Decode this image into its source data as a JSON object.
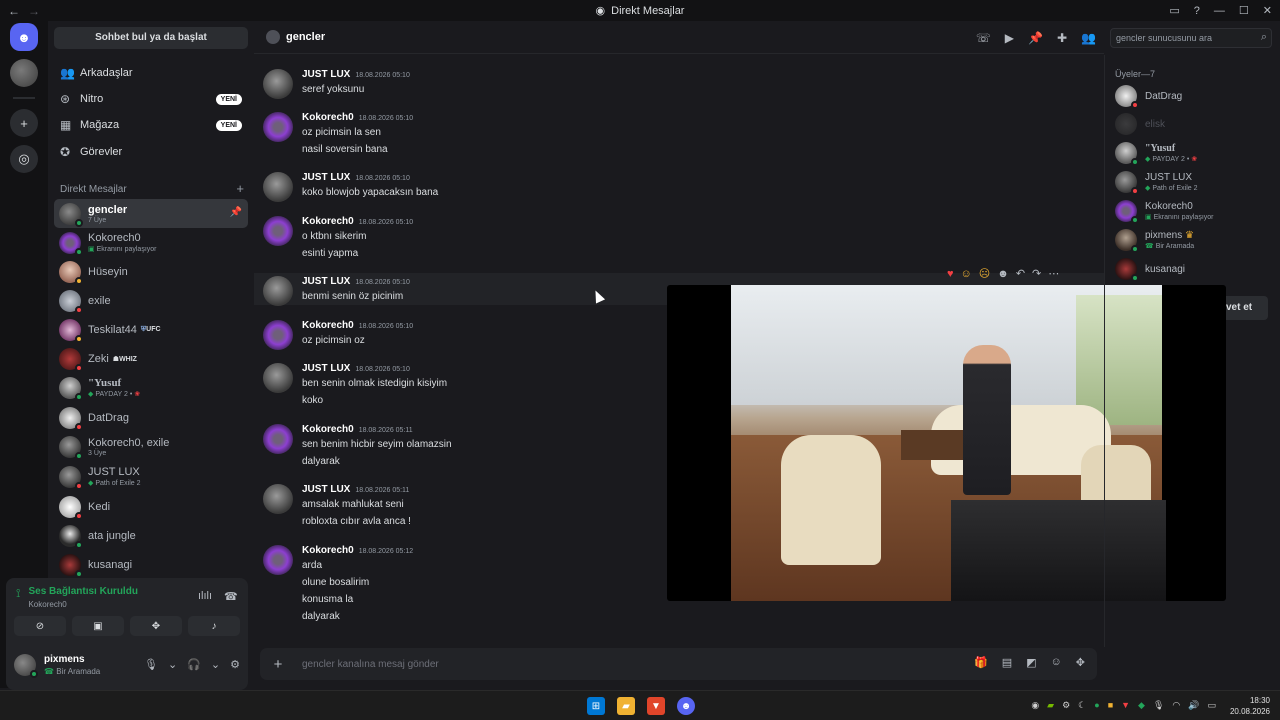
{
  "window": {
    "title": "Direkt Mesajlar"
  },
  "colors": {
    "accent": "#5865f2",
    "online": "#23a55a",
    "dnd": "#f23f43",
    "idle": "#f0b232",
    "voice": "#23a55a"
  },
  "sidebar": {
    "find_button": "Sohbet bul ya da başlat",
    "nav": [
      {
        "label": "Arkadaşlar",
        "icon": "friends-icon"
      },
      {
        "label": "Nitro",
        "icon": "nitro-icon",
        "badge": "YENİ"
      },
      {
        "label": "Mağaza",
        "icon": "shop-icon",
        "badge": "YENİ"
      },
      {
        "label": "Görevler",
        "icon": "quests-icon"
      }
    ],
    "dm_header": "Direkt Mesajlar",
    "dm_add": "+",
    "dms": [
      {
        "name": "gencler",
        "sub": "7 Üye",
        "selected": true
      },
      {
        "name": "Kokorech0",
        "sub": "Ekranını paylaşıyor"
      },
      {
        "name": "Hüseyin",
        "sub": ""
      },
      {
        "name": "exile",
        "sub": ""
      },
      {
        "name": "Teskilat44",
        "sub": "",
        "tag": "UFC"
      },
      {
        "name": "Zeki",
        "sub": "",
        "tag": "WHIZ"
      },
      {
        "name": "\"Yusuf",
        "sub": "PAYDAY 2 •"
      },
      {
        "name": "DatDrag",
        "sub": ""
      },
      {
        "name": "Kokorech0, exile",
        "sub": "3 Üye"
      },
      {
        "name": "JUST LUX",
        "sub": "Path of Exile 2"
      },
      {
        "name": "Kedi",
        "sub": ""
      },
      {
        "name": "ata jungle",
        "sub": ""
      },
      {
        "name": "kusanagi",
        "sub": ""
      }
    ]
  },
  "voice": {
    "title": "Ses Bağlantısı Kuruldu",
    "channel": "Kokorech0"
  },
  "user": {
    "name": "pixmens",
    "status": "Bir Aramada"
  },
  "chat": {
    "channel": "gencler",
    "search_placeholder": "gencler sunucusunu ara",
    "input_placeholder": "gencler kanalına mesaj gönder",
    "messages": [
      {
        "author": "JUST LUX",
        "time": "18.08.2026 05:10",
        "lines": [
          "seref yoksunu"
        ],
        "av": "av-lux"
      },
      {
        "author": "Kokorech0",
        "time": "18.08.2026 05:10",
        "lines": [
          "oz picimsin la sen",
          "nasil soversin bana"
        ],
        "av": "av-kok"
      },
      {
        "author": "JUST LUX",
        "time": "18.08.2026 05:10",
        "lines": [
          "koko blowjob yapacaksın bana"
        ],
        "av": "av-lux"
      },
      {
        "author": "Kokorech0",
        "time": "18.08.2026 05:10",
        "lines": [
          "o ktbnı sikerim",
          "esinti yapma"
        ],
        "av": "av-kok"
      },
      {
        "author": "JUST LUX",
        "time": "18.08.2026 05:10",
        "lines": [
          "benmi senin öz picinim"
        ],
        "av": "av-lux",
        "hover": true
      },
      {
        "author": "Kokorech0",
        "time": "18.08.2026 05:10",
        "lines": [
          "oz picimsin oz"
        ],
        "av": "av-kok"
      },
      {
        "author": "JUST LUX",
        "time": "18.08.2026 05:10",
        "lines": [
          "ben senin olmak istedigin kisiyim",
          "koko"
        ],
        "av": "av-lux"
      },
      {
        "author": "Kokorech0",
        "time": "18.08.2026 05:11",
        "lines": [
          "sen benim hicbir seyim olamazsin",
          "dalyarak"
        ],
        "av": "av-kok"
      },
      {
        "author": "JUST LUX",
        "time": "18.08.2026 05:11",
        "lines": [
          "amsalak mahlukat seni",
          "robloxta cıbır avla anca !"
        ],
        "av": "av-lux"
      },
      {
        "author": "Kokorech0",
        "time": "18.08.2026 05:12",
        "lines": [
          "arda",
          "olune bosalirim",
          "konusma la",
          "dalyarak"
        ],
        "av": "av-kok"
      }
    ]
  },
  "members": {
    "header": "Üyeler—7",
    "list": [
      {
        "name": "DatDrag",
        "sub": ""
      },
      {
        "name": "elisk",
        "sub": "",
        "offline": true
      },
      {
        "name": "\"Yusuf",
        "sub": "PAYDAY 2 •"
      },
      {
        "name": "JUST LUX",
        "sub": "Path of Exile 2"
      },
      {
        "name": "Kokorech0",
        "sub": "Ekranını paylaşıyor"
      },
      {
        "name": "pixmens",
        "sub": "Bir Aramada"
      },
      {
        "name": "kusanagi",
        "sub": ""
      }
    ],
    "invite_label": "vet et"
  },
  "taskbar": {
    "time": "18:30",
    "date": "20.08.2026"
  }
}
